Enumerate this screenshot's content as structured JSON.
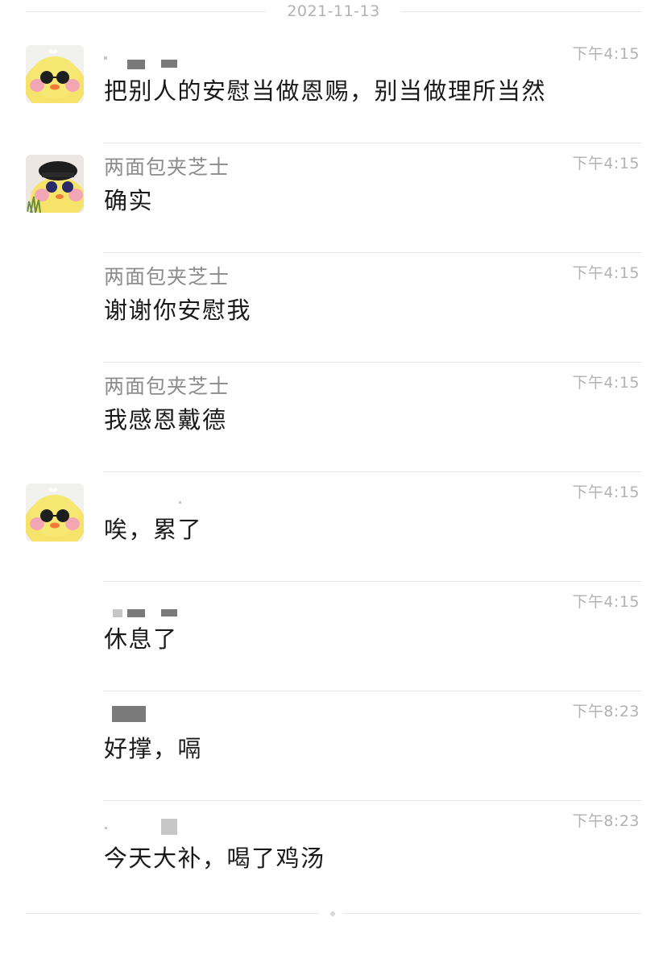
{
  "date_separator": "2021-11-13",
  "messages": [
    {
      "sender": "",
      "time": "下午4:15",
      "text": "把别人的安慰当做恩赐，别当做理所当然",
      "avatar": "yellow-duck"
    },
    {
      "sender": "两面包夹芝士",
      "time": "下午4:15",
      "text": "确实",
      "avatar": "duck-with-hat"
    },
    {
      "sender": "两面包夹芝士",
      "time": "下午4:15",
      "text": "谢谢你安慰我",
      "avatar": ""
    },
    {
      "sender": "两面包夹芝士",
      "time": "下午4:15",
      "text": "我感恩戴德",
      "avatar": ""
    },
    {
      "sender": "",
      "time": "下午4:15",
      "text": "唉，累了",
      "avatar": "yellow-duck"
    },
    {
      "sender": "",
      "time": "下午4:15",
      "text": "休息了",
      "avatar": ""
    },
    {
      "sender": "",
      "time": "下午8:23",
      "text": "好撑，嗝",
      "avatar": ""
    },
    {
      "sender": "",
      "time": "下午8:23",
      "text": "今天大补，喝了鸡汤",
      "avatar": ""
    }
  ],
  "colors": {
    "duck_yellow": "#f5e36a",
    "cheek_pink": "#f3a6b5",
    "beak_orange": "#f07a3a",
    "hat_black": "#1e1e1e"
  }
}
